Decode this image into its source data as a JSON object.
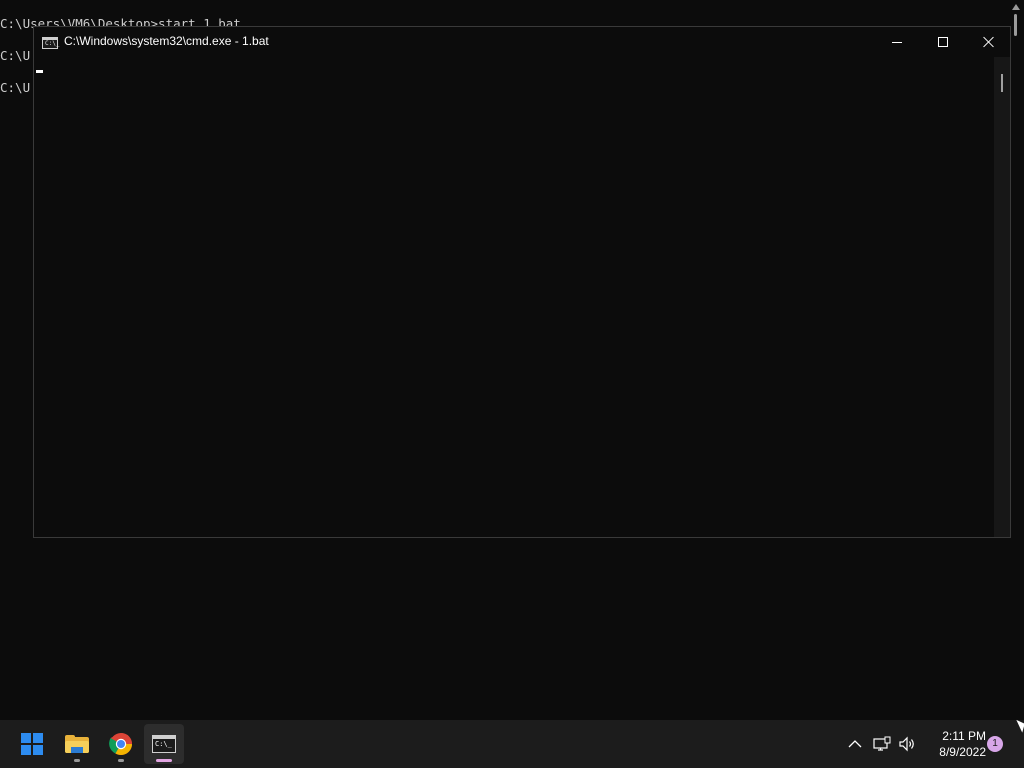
{
  "background_console": {
    "lines": [
      "C:\\Users\\VM6\\Desktop>start 1.bat",
      "C:\\U",
      "C:\\U"
    ]
  },
  "cmd_window": {
    "title": "C:\\Windows\\system32\\cmd.exe - 1.bat",
    "app_icon_text": "C:\\_",
    "icon": "cmd-app-icon",
    "buttons": {
      "minimize": "minimize-icon",
      "maximize": "maximize-icon",
      "close": "close-icon"
    }
  },
  "taskbar": {
    "items": [
      {
        "name": "Start",
        "icon": "windows-start-icon"
      },
      {
        "name": "File Explorer",
        "icon": "folder-icon"
      },
      {
        "name": "Google Chrome",
        "icon": "chrome-icon"
      },
      {
        "name": "Command Prompt",
        "icon": "terminal-icon",
        "active": true
      }
    ],
    "terminal_icon_text": "C:\\_",
    "tray": {
      "time": "2:11 PM",
      "date": "8/9/2022",
      "notification_count": "1"
    }
  },
  "colors": {
    "console_bg": "#0c0c0c",
    "taskbar_bg": "#1c1c1c",
    "accent_blue": "#2d8cf0",
    "active_indicator": "#e3a6e3"
  }
}
